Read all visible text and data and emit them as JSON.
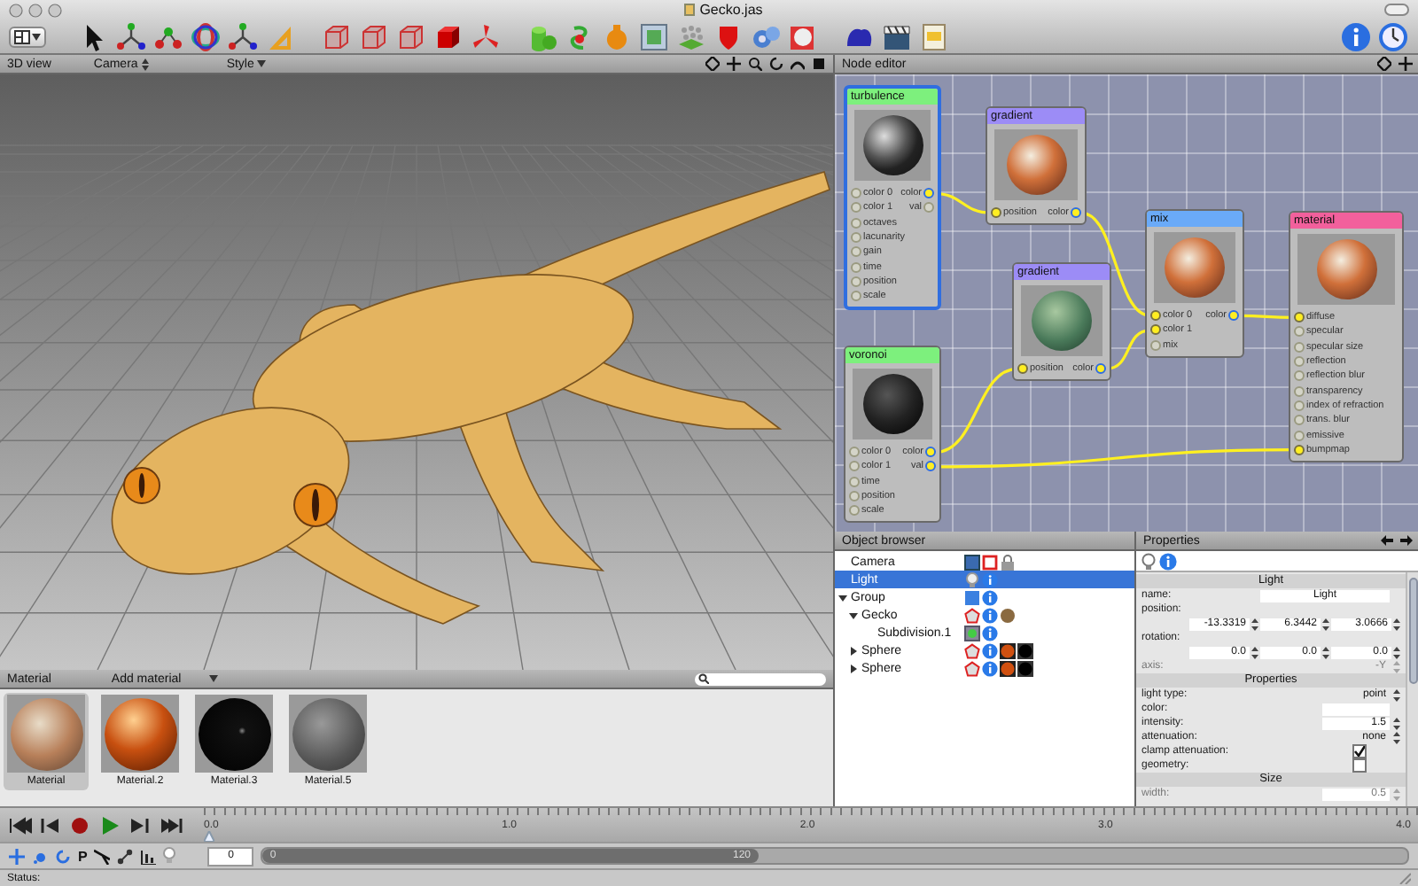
{
  "window": {
    "title": "Gecko.jas"
  },
  "view_header": {
    "title": "3D view",
    "camera": "Camera",
    "style": "Style"
  },
  "node_editor": {
    "title": "Node editor",
    "nodes": [
      {
        "title": "turbulence",
        "color": "#7df07d",
        "selected": true,
        "inputs": [
          {
            "label": "color 0",
            "linked": false
          },
          {
            "label": "color 1",
            "linked": false
          },
          {
            "label": "octaves",
            "linked": false
          },
          {
            "label": "lacunarity",
            "linked": false
          },
          {
            "label": "gain",
            "linked": false
          },
          {
            "label": "time",
            "linked": false
          },
          {
            "label": "position",
            "linked": false
          },
          {
            "label": "scale",
            "linked": false
          }
        ],
        "outputs": [
          {
            "label": "color",
            "linked": true
          },
          {
            "label": "val",
            "linked": false
          }
        ]
      },
      {
        "title": "gradient",
        "color": "#9c8cf6",
        "selected": false,
        "inputs": [
          {
            "label": "position",
            "linked": true
          }
        ],
        "outputs": [
          {
            "label": "color",
            "linked": true
          }
        ]
      },
      {
        "title": "mix",
        "color": "#6aaaf8",
        "selected": false,
        "inputs": [
          {
            "label": "color 0",
            "linked": true
          },
          {
            "label": "color 1",
            "linked": true
          },
          {
            "label": "mix",
            "linked": false
          }
        ],
        "outputs": [
          {
            "label": "color",
            "linked": true
          }
        ]
      },
      {
        "title": "material",
        "color": "#f2609c",
        "selected": false,
        "inputs": [
          {
            "label": "diffuse",
            "linked": true
          },
          {
            "label": "specular",
            "linked": false
          },
          {
            "label": "specular size",
            "linked": false
          },
          {
            "label": "reflection",
            "linked": false
          },
          {
            "label": "reflection blur",
            "linked": false
          },
          {
            "label": "transparency",
            "linked": false
          },
          {
            "label": "index of refraction",
            "linked": false
          },
          {
            "label": "trans. blur",
            "linked": false
          },
          {
            "label": "emissive",
            "linked": false
          },
          {
            "label": "bumpmap",
            "linked": true
          }
        ]
      },
      {
        "title": "gradient",
        "color": "#9c8cf6",
        "selected": false,
        "inputs": [
          {
            "label": "position",
            "linked": true
          }
        ],
        "outputs": [
          {
            "label": "color",
            "linked": true
          }
        ]
      },
      {
        "title": "voronoi",
        "color": "#7df07d",
        "selected": false,
        "inputs": [
          {
            "label": "color 0",
            "linked": false
          },
          {
            "label": "color 1",
            "linked": false
          },
          {
            "label": "time",
            "linked": false
          },
          {
            "label": "position",
            "linked": false
          },
          {
            "label": "scale",
            "linked": false
          }
        ],
        "outputs": [
          {
            "label": "color",
            "linked": true
          },
          {
            "label": "val",
            "linked": true
          }
        ]
      }
    ]
  },
  "object_browser": {
    "title": "Object browser",
    "items": [
      {
        "label": "Camera",
        "kind": "camera",
        "selected": false
      },
      {
        "label": "Light",
        "kind": "light",
        "selected": true
      },
      {
        "label": "Group",
        "kind": "group",
        "selected": false,
        "expanded": true,
        "children": [
          {
            "label": "Gecko",
            "kind": "mesh",
            "selected": false,
            "expanded": true,
            "children": [
              {
                "label": "Subdivision.1",
                "kind": "modifier",
                "selected": false
              }
            ]
          },
          {
            "label": "Sphere",
            "kind": "sphere",
            "selected": false,
            "expanded": false
          },
          {
            "label": "Sphere",
            "kind": "sphere",
            "selected": false,
            "expanded": false
          }
        ]
      }
    ]
  },
  "properties": {
    "title": "Properties",
    "sections": [
      {
        "title": "Light",
        "rows": [
          {
            "kind": "text",
            "label": "name:",
            "value": "Light"
          },
          {
            "kind": "label",
            "label": "position:"
          },
          {
            "kind": "vector",
            "values": [
              "-13.3319",
              "6.3442",
              "3.0666"
            ]
          },
          {
            "kind": "label",
            "label": "rotation:"
          },
          {
            "kind": "vector",
            "values": [
              "0.0",
              "0.0",
              "0.0"
            ]
          },
          {
            "kind": "select",
            "label": "axis:",
            "value": "-Y",
            "disabled": true
          }
        ]
      },
      {
        "title": "Properties",
        "rows": [
          {
            "kind": "select",
            "label": "light type:",
            "value": "point",
            "disabled": false
          },
          {
            "kind": "color",
            "label": "color:",
            "color": "#ffffff"
          },
          {
            "kind": "number",
            "label": "intensity:",
            "value": "1.5",
            "disabled": false
          },
          {
            "kind": "select",
            "label": "attenuation:",
            "value": "none",
            "disabled": false
          },
          {
            "kind": "checkbox",
            "label": "clamp attenuation:",
            "checked": true
          },
          {
            "kind": "checkbox",
            "label": "geometry:",
            "checked": false
          }
        ]
      },
      {
        "title": "Size",
        "rows": [
          {
            "kind": "number",
            "label": "width:",
            "value": "0.5",
            "disabled": true
          }
        ]
      }
    ]
  },
  "materials": {
    "title": "Material",
    "add_label": "Add material",
    "items": [
      {
        "label": "Material",
        "selected": true
      },
      {
        "label": "Material.2",
        "selected": false
      },
      {
        "label": "Material.3",
        "selected": false
      },
      {
        "label": "Material.5",
        "selected": false
      }
    ]
  },
  "timeline": {
    "ticks": [
      "0.0",
      "1.0",
      "2.0",
      "3.0",
      "4.0"
    ]
  },
  "tools": {
    "letter_tool": "P",
    "frame": "0",
    "range_start": "0",
    "range_end": "120"
  },
  "status_bar": {
    "text": "Status:"
  }
}
